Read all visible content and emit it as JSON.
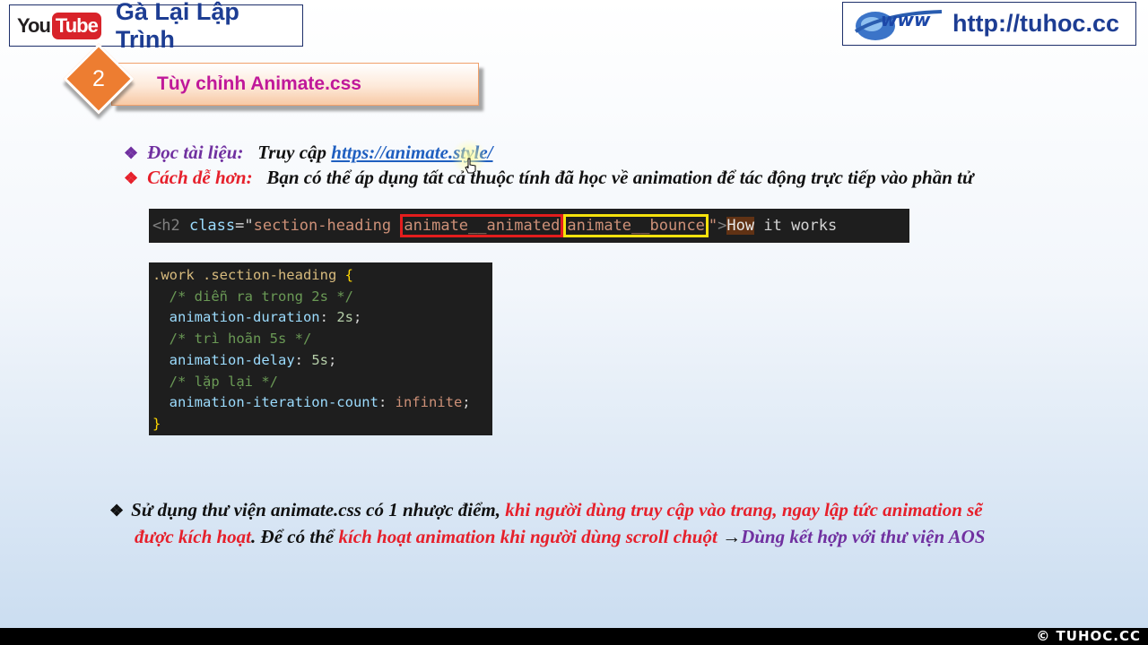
{
  "header": {
    "youtube_logo": {
      "you": "You",
      "tube": "Tube"
    },
    "channel_name": "Gà Lại Lập Trình",
    "site_url": "http://tuhoc.cc",
    "www_logo": "www"
  },
  "section": {
    "number": "2",
    "title": "Tùy chỉnh Animate.css"
  },
  "bullets": [
    {
      "label": "Đọc tài liệu:",
      "text": "Truy cập",
      "link": "https://animate.style/"
    },
    {
      "label": "Cách dễ hơn:",
      "text": "Bạn có thể áp dụng tất cả thuộc tính đã học về animation để tác động trực tiếp vào phần tử"
    }
  ],
  "code_html": {
    "open": "<h2 ",
    "attr": "class",
    "eq": "=\"",
    "class1": "section-heading ",
    "class2": "animate__animated",
    "class3": "animate__bounce",
    "close_quote": "\"",
    "gt": ">",
    "how": "How",
    "rest": " it works"
  },
  "code_css": {
    "selector": ".work .section-heading ",
    "open_brace": "{",
    "lines": [
      {
        "type": "comment",
        "text": "/* diễn ra trong 2s */"
      },
      {
        "type": "decl",
        "prop": "animation-duration",
        "value": "2s"
      },
      {
        "type": "comment",
        "text": "/* trì hoãn 5s */"
      },
      {
        "type": "decl",
        "prop": "animation-delay",
        "value": "5s"
      },
      {
        "type": "comment",
        "text": "/* lặp lại */"
      },
      {
        "type": "decl",
        "prop": "animation-iteration-count",
        "value": "infinite"
      }
    ],
    "close_brace": "}"
  },
  "note": {
    "part1": "Sử dụng thư viện animate.css có 1 nhược điểm,",
    "part2": "khi người dùng truy cập vào trang, ngay lập tức animation sẽ",
    "part3": "được kích hoạt",
    "part4": ". Để có thể",
    "part5": "kích hoạt animation khi người dùng scroll chuột",
    "arrow": "→",
    "part6": "Dùng kết hợp với thư viện AOS"
  },
  "footer": {
    "brand": "TUHOC.CC"
  }
}
